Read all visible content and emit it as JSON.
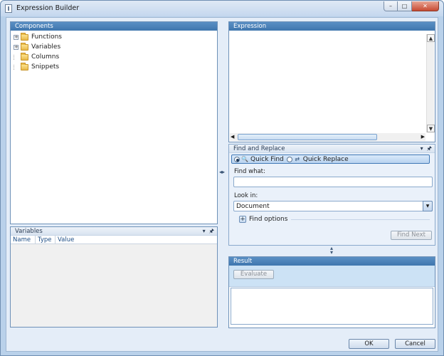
{
  "window": {
    "title": "Expression Builder",
    "controls": {
      "minimize": "–",
      "maximize": "□",
      "close": "✕"
    }
  },
  "components": {
    "header": "Components",
    "items": [
      {
        "label": "Functions",
        "expandable": true
      },
      {
        "label": "Variables",
        "expandable": true
      },
      {
        "label": "Columns",
        "expandable": false
      },
      {
        "label": "Snippets",
        "expandable": false
      }
    ]
  },
  "variables_panel": {
    "header": "Variables",
    "columns": [
      "Name",
      "Type",
      "Value"
    ]
  },
  "expression": {
    "header": "Expression",
    "value": ""
  },
  "find_replace": {
    "header": "Find and Replace",
    "modes": [
      {
        "label": "Quick Find",
        "selected": true
      },
      {
        "label": "Quick Replace",
        "selected": false
      }
    ],
    "find_what_label": "Find what:",
    "find_what_value": "",
    "look_in_label": "Look in:",
    "look_in_value": "Document",
    "find_options_label": "Find options",
    "find_next_label": "Find Next"
  },
  "result": {
    "header": "Result",
    "evaluate_label": "Evaluate",
    "value": ""
  },
  "footer": {
    "ok_label": "OK",
    "cancel_label": "Cancel"
  }
}
